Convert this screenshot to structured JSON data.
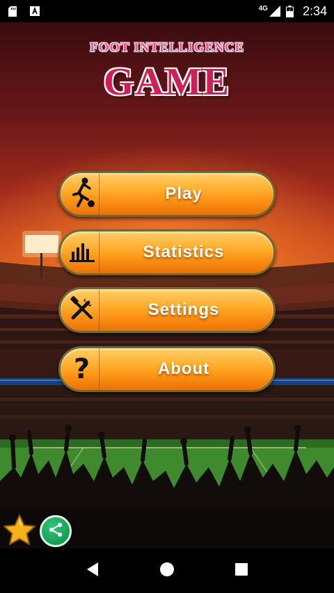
{
  "status_bar": {
    "network_label": "4G",
    "time": "2:34",
    "icons": [
      "sd-card-icon",
      "text-a-icon",
      "signal-icon",
      "battery-charging-icon"
    ]
  },
  "title": {
    "subtitle": "FOOT INTELLIGENCE",
    "main": "GAME"
  },
  "menu": {
    "items": [
      {
        "label": "Play",
        "icon": "soccer-player-icon"
      },
      {
        "label": "Statistics",
        "icon": "bar-chart-icon"
      },
      {
        "label": "Settings",
        "icon": "tools-icon"
      },
      {
        "label": "About",
        "icon": "question-mark-icon"
      }
    ]
  },
  "floating": {
    "rate_icon": "star-icon",
    "share_icon": "share-icon"
  },
  "nav": {
    "back": "back-icon",
    "home": "home-icon",
    "recents": "recents-icon"
  },
  "colors": {
    "title_pink": "#d01e56",
    "button_orange": "#fb8e12",
    "button_border": "#6b6a3a",
    "share_green": "#0f8a48",
    "star_gold": "#f6b21a"
  }
}
